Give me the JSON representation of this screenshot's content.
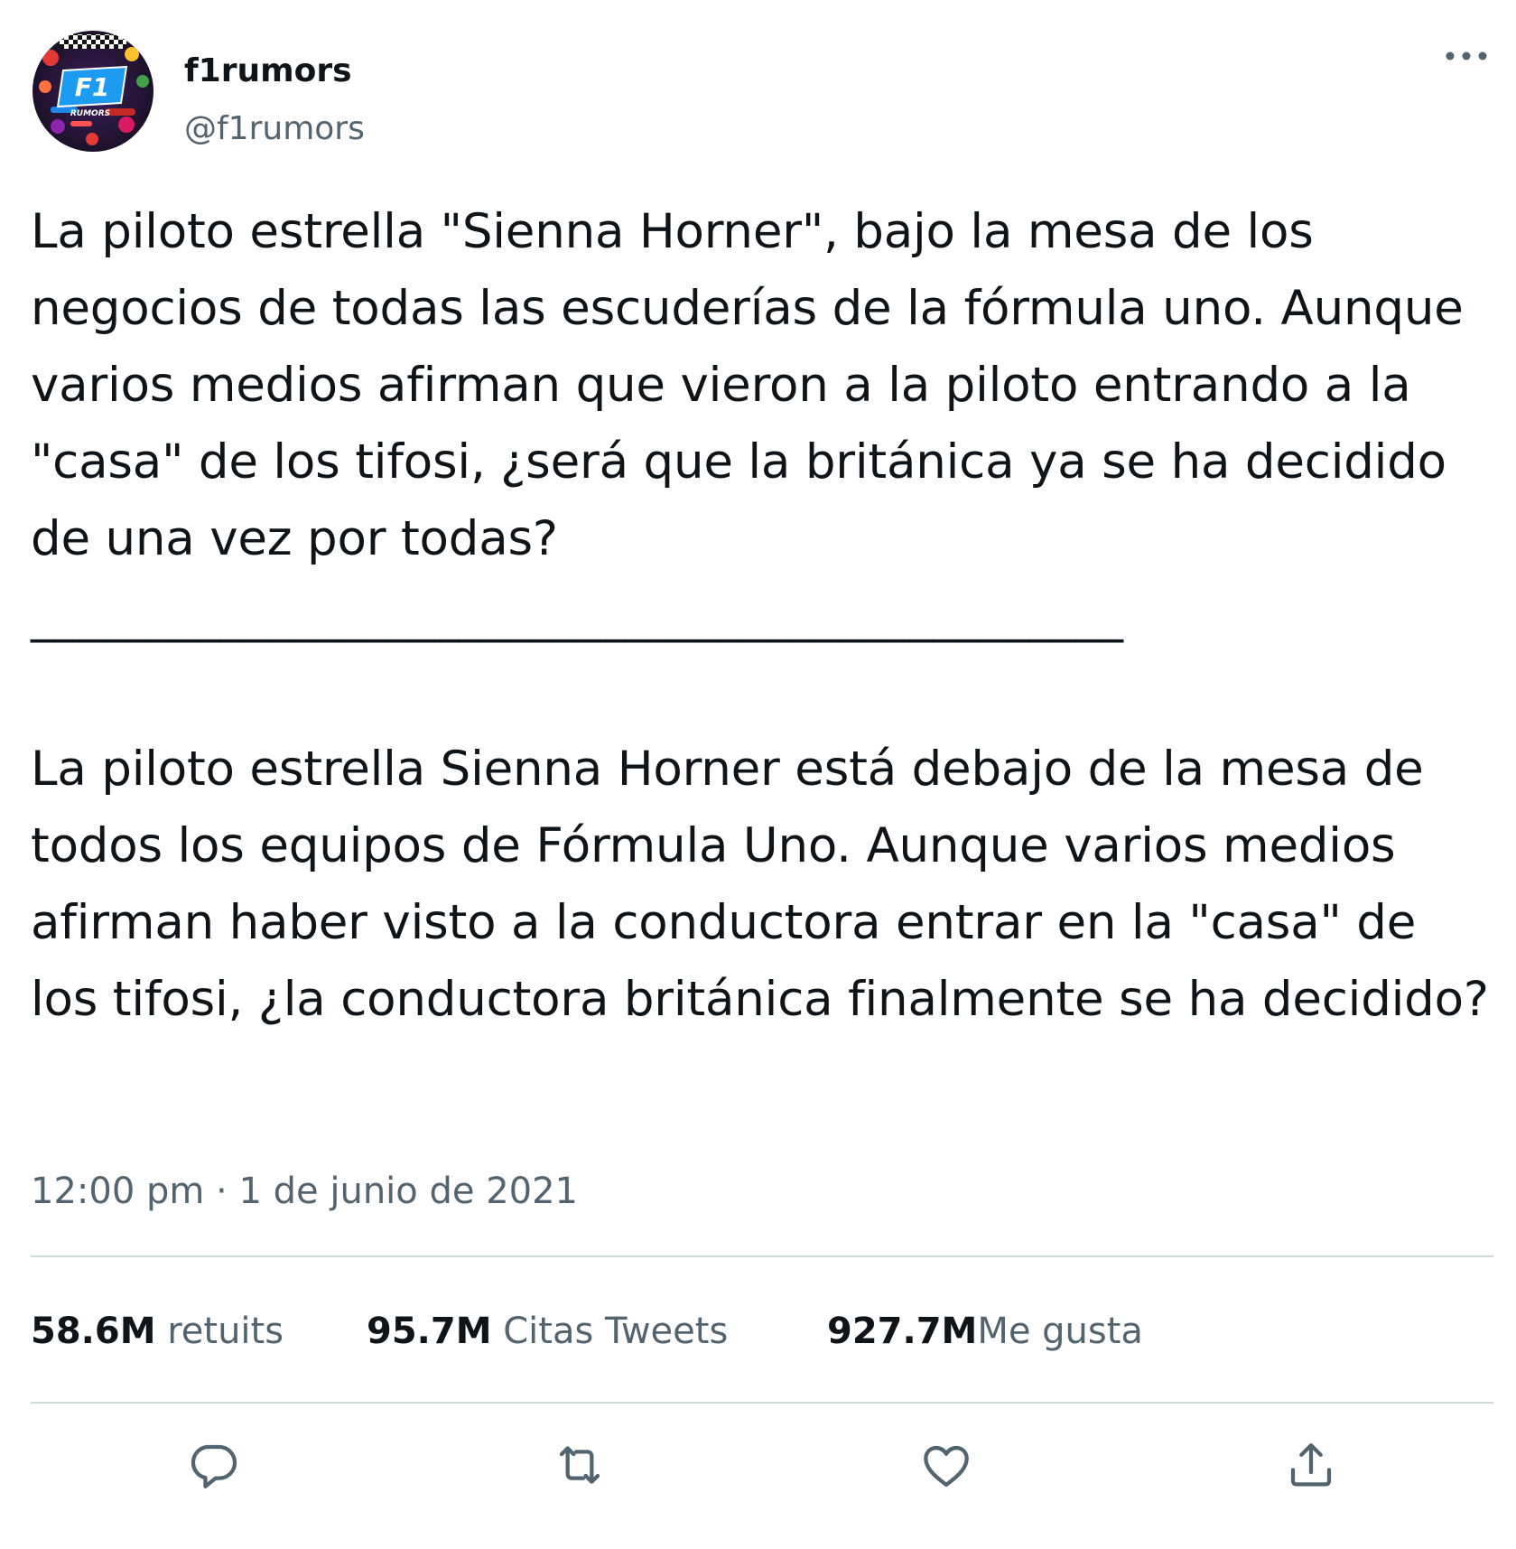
{
  "author": {
    "display_name": "f1rumors",
    "handle": "@f1rumors",
    "avatar_text": "F1",
    "avatar_subtext": "RUMORS"
  },
  "tweet": {
    "text": "La piloto estrella \"Sienna Horner\", bajo la mesa de los negocios de todas las escuderías de la fórmula uno. Aunque varios medios afirman que vieron a la piloto entrando a la \"casa\" de los tifosi, ¿será que la británica ya se ha decidido de una vez por todas?\n______________________________________________\n\nLa piloto estrella Sienna Horner está debajo de la mesa de todos los equipos de Fórmula Uno. Aunque varios medios afirman haber visto a la conductora entrar en la \"casa\" de los tifosi, ¿la conductora británica finalmente se ha decidido?",
    "timestamp": "12:00 pm · 1 de junio de 2021"
  },
  "stats": {
    "retweets": {
      "count": "58.6M",
      "label": "retuits"
    },
    "quotes": {
      "count": "95.7M",
      "label": "Citas Tweets"
    },
    "likes": {
      "count": "927.7M",
      "label": "Me gusta"
    }
  },
  "actions": {
    "reply_icon": "speech-bubble-icon",
    "retweet_icon": "retweet-arrows-icon",
    "like_icon": "heart-icon",
    "share_icon": "upload-share-icon"
  },
  "colors": {
    "text": "#0f1419",
    "secondary": "#536471",
    "divider": "#cfd9de",
    "avatar_badge": "#1d9bf0"
  }
}
